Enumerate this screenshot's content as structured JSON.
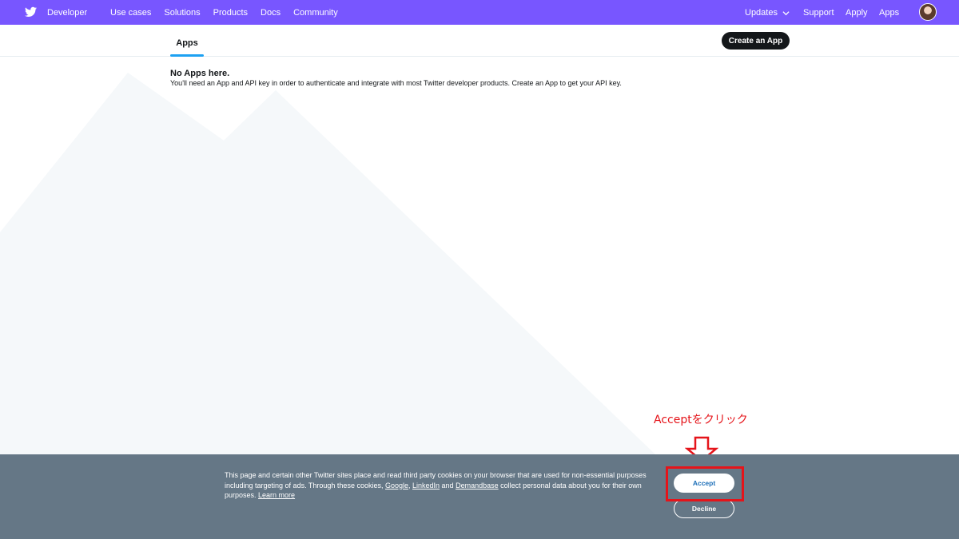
{
  "topnav": {
    "brand": "Developer",
    "links": [
      "Use cases",
      "Solutions",
      "Products",
      "Docs",
      "Community"
    ],
    "updates": "Updates",
    "support": "Support",
    "apply": "Apply",
    "apps": "Apps",
    "icons": {
      "logo": "twitter-bird-icon",
      "updates_menu": "chevron-down-icon",
      "user": "avatar"
    }
  },
  "subheader": {
    "tab": "Apps",
    "create_button": "Create an App"
  },
  "content": {
    "title": "No Apps here.",
    "description": "You'll need an App and API key in order to authenticate and integrate with most Twitter developer products. Create an App to get your API key."
  },
  "cookie": {
    "text_before": "This page and certain other Twitter sites place and read third party cookies on your browser that are used for non-essential purposes including targeting of ads. Through these cookies, ",
    "link_google": "Google",
    "sep1": ", ",
    "link_linkedin": "LinkedIn",
    "sep2": " and ",
    "link_demandbase": "Demandbase",
    "text_after": " collect personal data about you for their own purposes. ",
    "link_learn": "Learn more",
    "accept": "Accept",
    "decline": "Decline"
  },
  "annotation": {
    "label": "Acceptをクリック"
  },
  "colors": {
    "nav_bg": "#7856ff",
    "tab_underline": "#1da1f2",
    "cookie_bg": "#657786",
    "annotation": "#e5141a"
  }
}
